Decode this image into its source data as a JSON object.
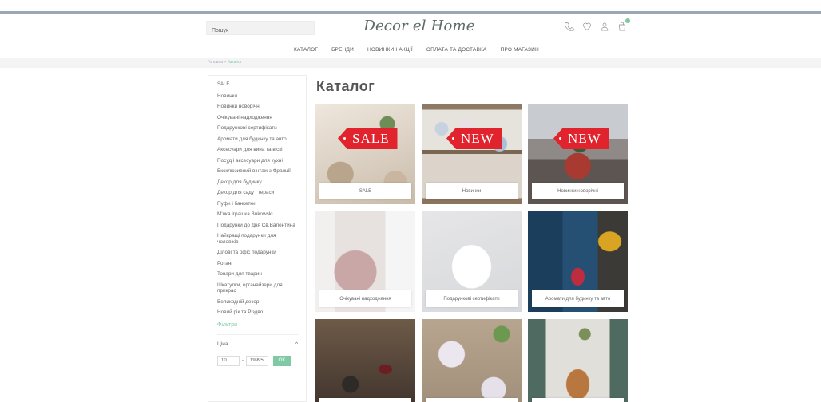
{
  "header": {
    "search_placeholder": "Пошук",
    "logo": "Decor el Home",
    "icons": [
      "phone-icon",
      "heart-icon",
      "user-icon",
      "cart-icon"
    ]
  },
  "nav": {
    "items": [
      "КАТАЛОГ",
      "БРЕНДИ",
      "НОВИНКИ І АКЦІЇ",
      "ОПЛАТА ТА ДОСТАВКА",
      "ПРО МАГАЗИН"
    ]
  },
  "breadcrumb": {
    "home": "Головна",
    "separator": ">",
    "current": "Каталог"
  },
  "sidebar": {
    "categories": [
      "SALE",
      "Новинки",
      "Новинки новорічні",
      "Очікувані надходження",
      "Подарункові сертифікати",
      "Аромати для будинку та авто",
      "Аксесуари для вина та віскі",
      "Посуд і аксесуари для кухні",
      "Ексклюзивний вінтаж з Франції",
      "Декор для будинку",
      "Декор для саду і тераси",
      "Пуфи і банкетки",
      "М'яка іграшка Bukowski",
      "Подарунки до Дня Св.Валентина",
      "Найкращі подарунки для чоловіків",
      "Ділові та офіс подарунки",
      "Ротанг",
      "Товари для тварин",
      "Шкатулки, органайзери для прикрас",
      "Великодній декор",
      "Новий рік та Різдво"
    ],
    "filters_title": "Фільтри",
    "price_label": "Ціна",
    "price_chevron": "^",
    "price_min": "10",
    "price_sep": "-",
    "price_max": "19995",
    "ok_label": "OK"
  },
  "main": {
    "title": "Каталог",
    "tiles": [
      {
        "label": "SALE",
        "tag": "SALE"
      },
      {
        "label": "Новинки",
        "tag": "NEW"
      },
      {
        "label": "Новинки новорічні",
        "tag": "NEW"
      },
      {
        "label": "Очікувані надходження"
      },
      {
        "label": "Подарункові сертифікати"
      },
      {
        "label": "Аромати для будинку та авто"
      },
      {
        "label": ""
      },
      {
        "label": ""
      },
      {
        "label": ""
      }
    ]
  },
  "colors": {
    "accent": "#7fc9a5",
    "tag_red": "#e0232d",
    "top_bar": "#9aa7b4"
  }
}
